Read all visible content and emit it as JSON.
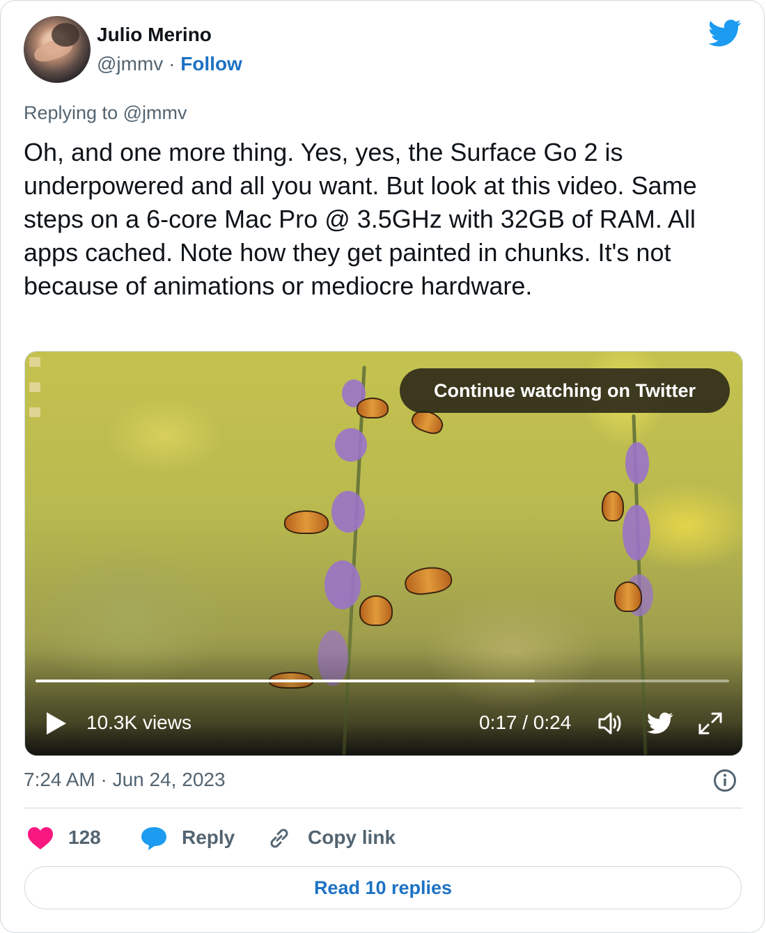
{
  "author": {
    "name": "Julio Merino",
    "handle": "@jmmv",
    "separator": "·",
    "follow_label": "Follow"
  },
  "tweet": {
    "replying_to": "Replying to @jmmv",
    "text": "Oh, and one more thing. Yes, yes, the Surface Go 2 is underpowered and all you want. But look at this video. Same steps on a 6-core Mac Pro @ 3.5GHz with 32GB of RAM. All apps cached. Note how they get painted in chunks. It's not because of animations or mediocre hardware.",
    "timestamp": "7:24 AM · Jun 24, 2023"
  },
  "video": {
    "continue_label": "Continue watching on Twitter",
    "views": "10.3K views",
    "time": "0:17 / 0:24",
    "progress": 0.72
  },
  "actions": {
    "likes": "128",
    "reply_label": "Reply",
    "copy_link_label": "Copy link",
    "read_replies_label": "Read 10 replies"
  },
  "colors": {
    "accent": "#1d72c4",
    "like": "#f91880",
    "twitter_blue": "#1d9bf0"
  }
}
